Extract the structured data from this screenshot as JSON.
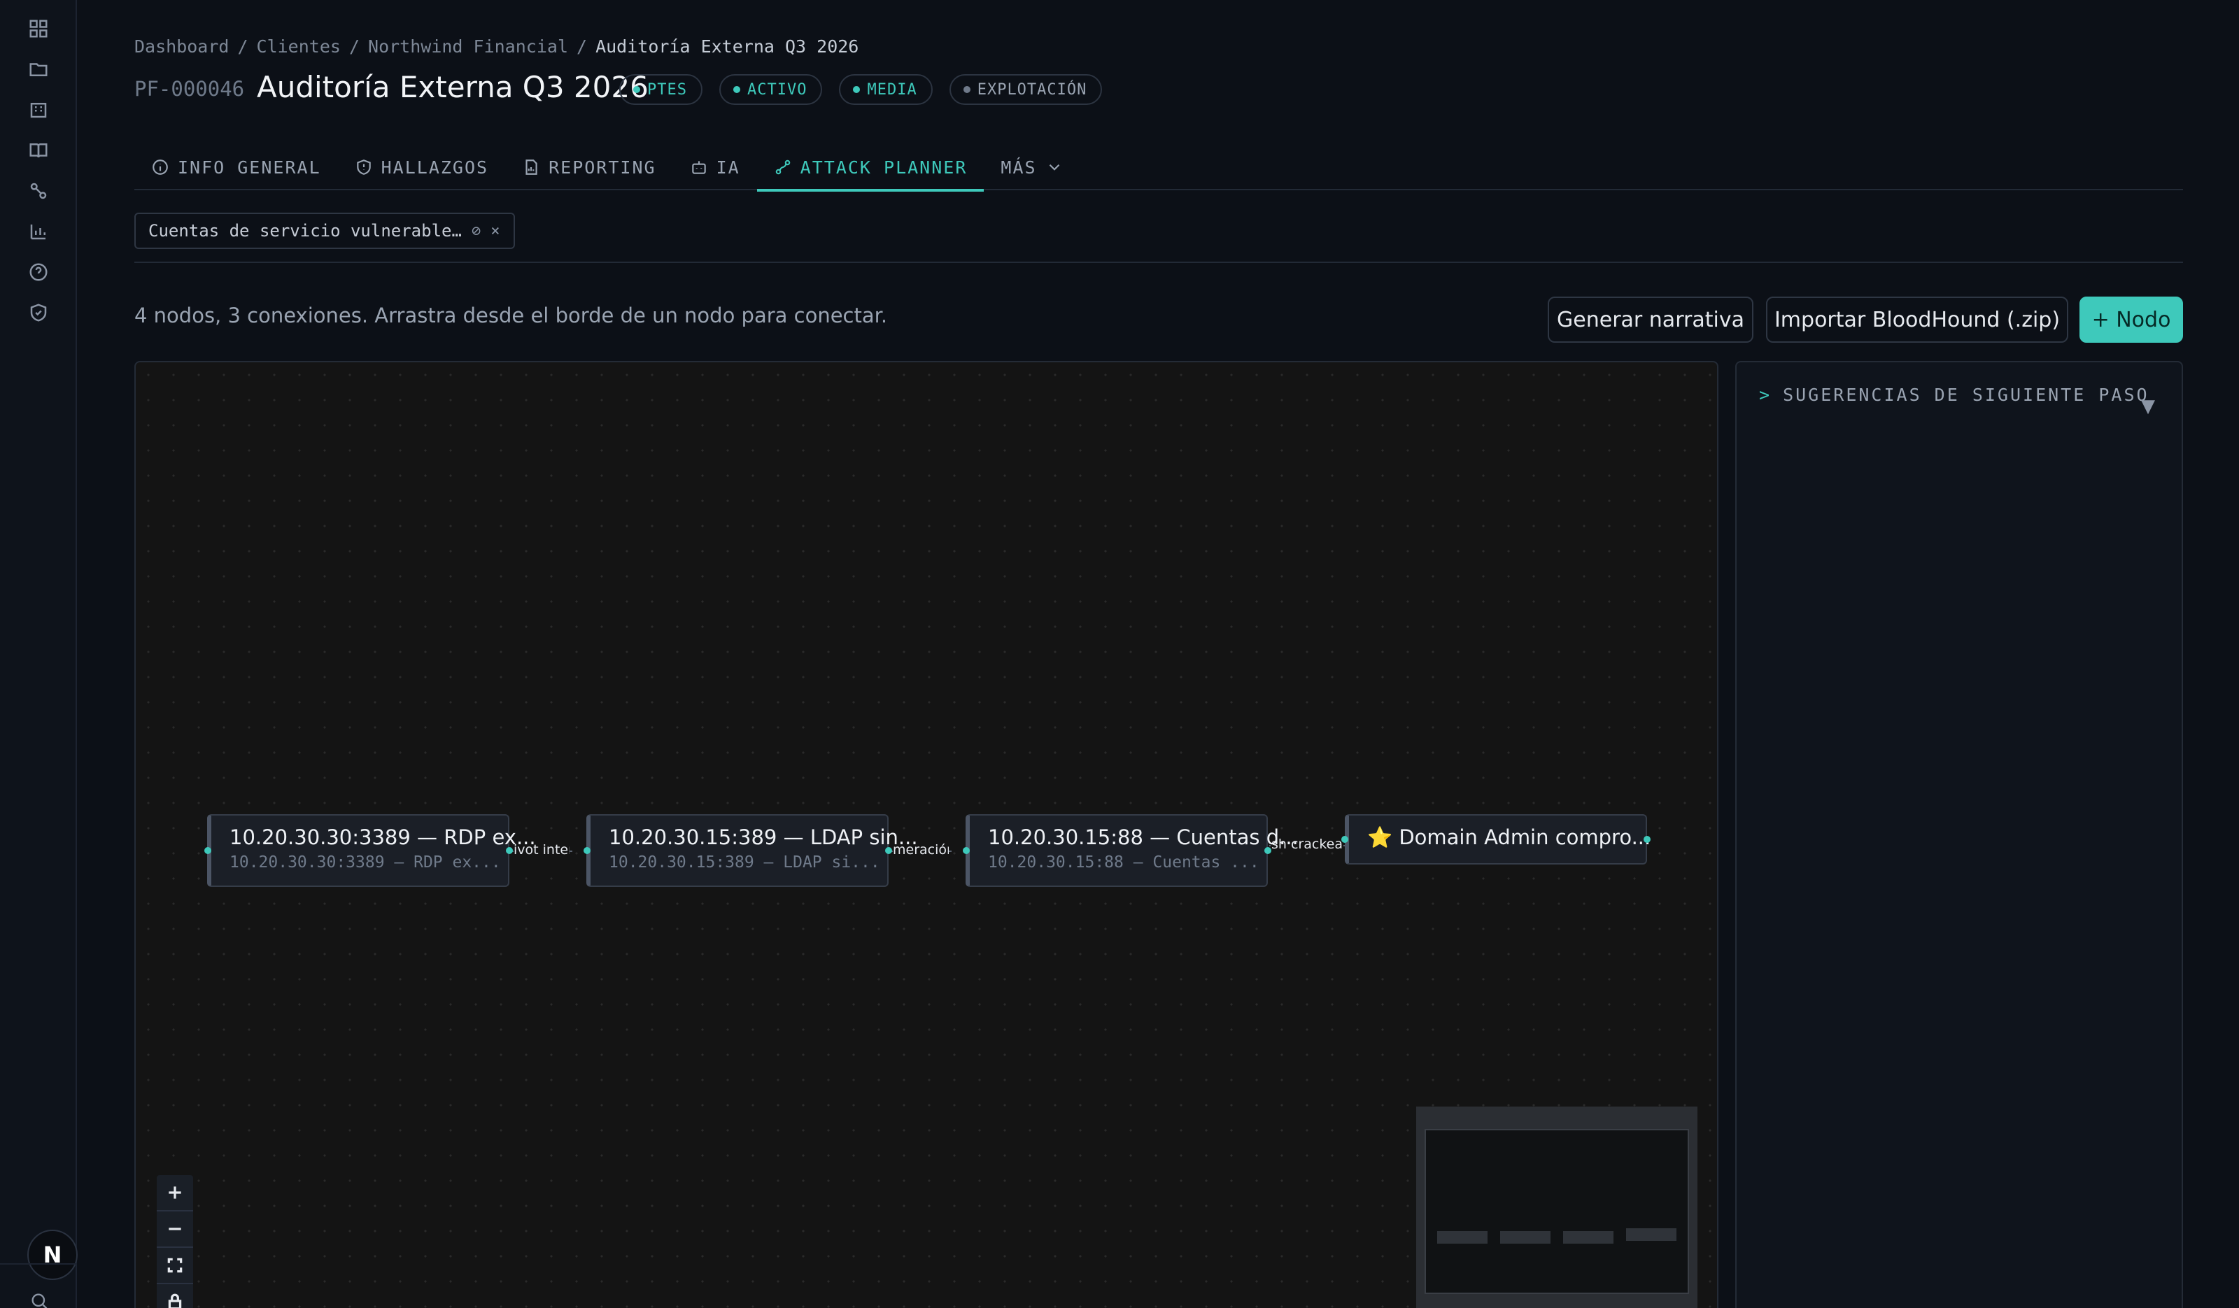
{
  "breadcrumb": [
    "Dashboard",
    "Clientes",
    "Northwind Financial",
    "Auditoría Externa Q3 2026"
  ],
  "project": {
    "id": "PF-000046",
    "title": "Auditoría Externa Q3 2026",
    "badges": [
      {
        "label": "PTES",
        "color": "#3ec9bb"
      },
      {
        "label": "ACTIVO",
        "color": "#3ec9bb"
      },
      {
        "label": "MEDIA",
        "color": "#3ec9bb"
      },
      {
        "label": "EXPLOTACIÓN",
        "color": "#6f7a8a"
      }
    ]
  },
  "tabs": [
    {
      "label": "INFO GENERAL",
      "icon": "info-icon"
    },
    {
      "label": "HALLAZGOS",
      "icon": "shield-icon"
    },
    {
      "label": "REPORTING",
      "icon": "report-icon"
    },
    {
      "label": "IA",
      "icon": "robot-icon"
    },
    {
      "label": "ATTACK PLANNER",
      "icon": "graph-icon",
      "active": true
    },
    {
      "label": "MÁS",
      "icon": "chevron-down-icon"
    }
  ],
  "filter": {
    "chip_label": "Cuentas de servicio vulnerable…"
  },
  "toolbar": {
    "info": "4 nodos, 3 conexiones. Arrastra desde el borde de un nodo para conectar.",
    "narrative_button": "Generar narrativa",
    "import_button": "Importar BloodHound (.zip)",
    "add_node_button": "+ Nodo"
  },
  "graph": {
    "nodes": [
      {
        "title": "10.20.30.30:3389 — RDP ex...",
        "subtitle": "10.20.30.30:3389 — RDP ex..."
      },
      {
        "title": "10.20.30.15:389 — LDAP sin...",
        "subtitle": "10.20.30.15:389 — LDAP si..."
      },
      {
        "title": "10.20.30.15:88 — Cuentas d...",
        "subtitle": "10.20.30.15:88 — Cuentas ..."
      },
      {
        "title": "⭐ Domain Admin compro...",
        "subtitle": ""
      }
    ],
    "edges": [
      "ivot intern",
      "meración S",
      "sh crackea"
    ]
  },
  "panel": {
    "title": "SUGERENCIAS DE SIGUIENTE PASO",
    "prompt": ">",
    "caret": "▼"
  },
  "user": {
    "initial": "N"
  }
}
